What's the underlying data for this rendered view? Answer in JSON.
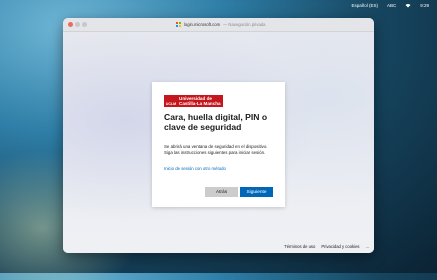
{
  "menubar": {
    "apple_glyph": "",
    "language": "Español (ES)",
    "icon": "ABC",
    "wifi_icon": "wifi-icon",
    "clock": "9:29"
  },
  "window": {
    "url_domain": "login.microsoft.com",
    "url_mode": "— Navegación privada"
  },
  "card": {
    "logo_mark": "UCLM",
    "logo_line1": "Universidad de",
    "logo_line2": "Castilla-La Mancha",
    "heading": "Cara, huella digital, PIN o clave de seguridad",
    "description": "Se abrirá una ventana de seguridad en el dispositivo. Siga las instrucciones siguientes para iniciar sesión.",
    "alt_link": "Inicio de sesión con otro método",
    "back_button": "Atrás",
    "next_button": "Siguiente"
  },
  "footer": {
    "terms": "Términos de uso",
    "privacy": "Privacidad y cookies",
    "more": "..."
  },
  "colors": {
    "brand_red": "#c4161c",
    "primary_blue": "#0067b8"
  }
}
